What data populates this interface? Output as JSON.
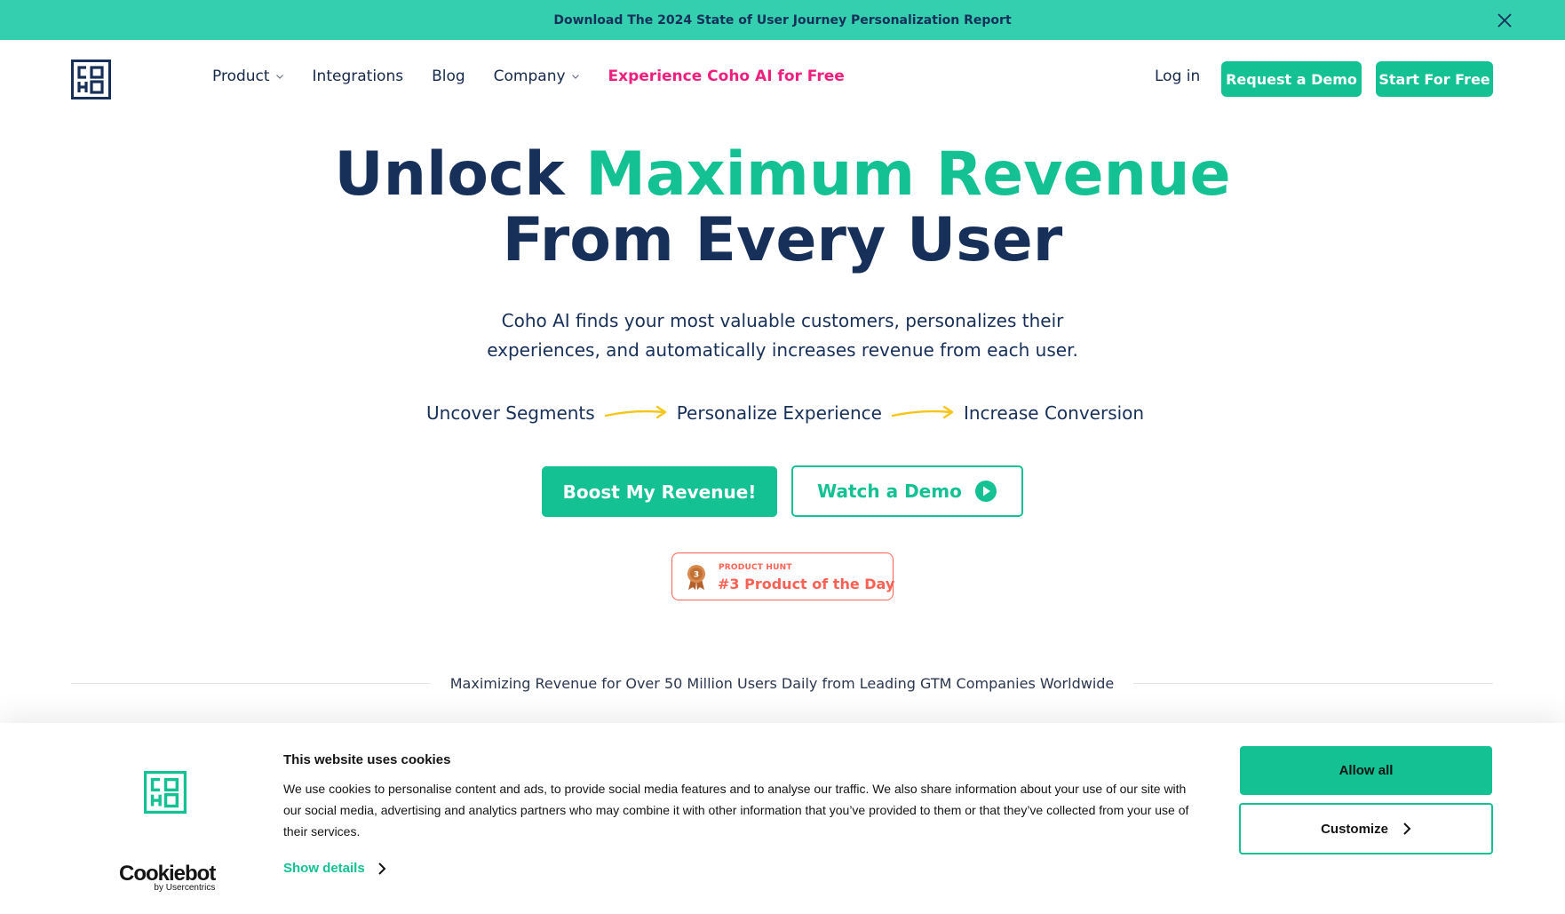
{
  "banner": {
    "text": "Download The 2024 State of User Journey Personalization Report",
    "close_icon": "close-icon"
  },
  "nav": {
    "logo_icon": "coho-logo",
    "links": [
      {
        "label": "Product",
        "has_dropdown": true
      },
      {
        "label": "Integrations",
        "has_dropdown": false
      },
      {
        "label": "Blog",
        "has_dropdown": false
      },
      {
        "label": "Company",
        "has_dropdown": true
      },
      {
        "label": "Experience Coho AI for Free",
        "has_dropdown": false
      }
    ],
    "login": "Log in",
    "request_demo": "Request a Demo",
    "start_free": "Start For Free"
  },
  "hero": {
    "title_part1": "Unlock",
    "title_accent": "Maximum Revenue",
    "title_line2": "From Every User",
    "subtitle_line1": "Coho AI finds your most valuable customers, personalizes their",
    "subtitle_line2": "experiences, and automatically increases revenue from each user.",
    "steps": [
      "Uncover Segments",
      "Personalize Experience",
      "Increase Conversion"
    ],
    "cta_primary": "Boost My Revenue!",
    "cta_secondary": "Watch a Demo"
  },
  "product_hunt": {
    "label": "PRODUCT HUNT",
    "title": "#3 Product of the Day",
    "rank": "3"
  },
  "trust": {
    "text": "Maximizing Revenue for Over 50 Million Users Daily from Leading GTM Companies Worldwide"
  },
  "cookie": {
    "title": "This website uses cookies",
    "body": "We use cookies to personalise content and ads, to provide social media features and to analyse our traffic. We also share information about your use of our site with our social media, advertising and analytics partners who may combine it with other information that you’ve provided to them or that they’ve collected from your use of their services.",
    "show_details": "Show details",
    "allow_all": "Allow all",
    "customize": "Customize",
    "brand": "Cookiebot",
    "brand_by": "by Usercentrics"
  },
  "colors": {
    "accent": "#13c193",
    "banner": "#33cfae",
    "navy": "#17305a",
    "pink": "#ef1f7e",
    "product_hunt": "#ff6154",
    "step_arrow": "#f5c518"
  }
}
